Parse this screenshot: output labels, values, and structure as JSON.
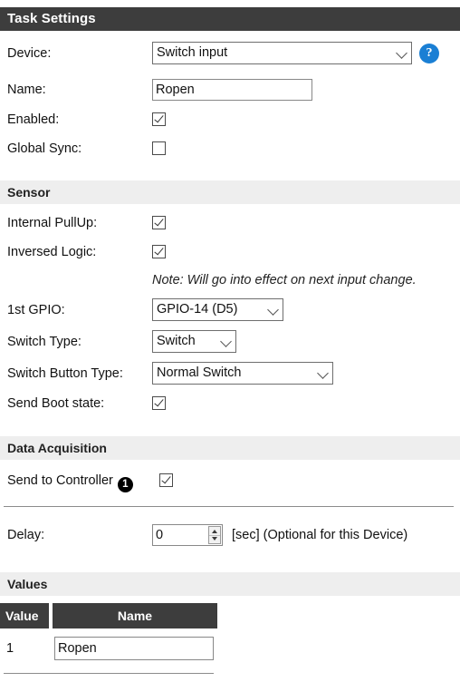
{
  "sections": {
    "task_settings": "Task Settings",
    "sensor": "Sensor",
    "data_acquisition": "Data Acquisition",
    "values": "Values"
  },
  "task_settings": {
    "device_label": "Device:",
    "device_value": "Switch input",
    "help_icon": "?",
    "name_label": "Name:",
    "name_value": "Ropen",
    "name_placeholder": "",
    "enabled_label": "Enabled:",
    "enabled_checked": true,
    "global_sync_label": "Global Sync:",
    "global_sync_checked": false
  },
  "sensor": {
    "internal_pullup_label": "Internal PullUp:",
    "internal_pullup_checked": true,
    "inversed_logic_label": "Inversed Logic:",
    "inversed_logic_checked": true,
    "note": "Note: Will go into effect on next input change.",
    "gpio_label": "1st GPIO:",
    "gpio_value": "GPIO-14 (D5)",
    "switch_type_label": "Switch Type:",
    "switch_type_value": "Switch",
    "switch_button_type_label": "Switch Button Type:",
    "switch_button_type_value": "Normal Switch",
    "send_boot_state_label": "Send Boot state:",
    "send_boot_state_checked": true
  },
  "data_acquisition": {
    "send_to_controller_label": "Send to Controller",
    "send_to_controller_badge": "1",
    "send_to_controller_checked": true,
    "delay_label": "Delay:",
    "delay_value": "0",
    "delay_unit": "[sec] (Optional for this Device)"
  },
  "values_table": {
    "headers": [
      "Value",
      "Name"
    ],
    "rows": [
      {
        "value": "1",
        "name": "Ropen"
      }
    ]
  },
  "colors": {
    "header_dark": "#3d3d3d",
    "header_light": "#eeeeee",
    "help_blue": "#1a7fd4",
    "badge_black": "#000000"
  }
}
